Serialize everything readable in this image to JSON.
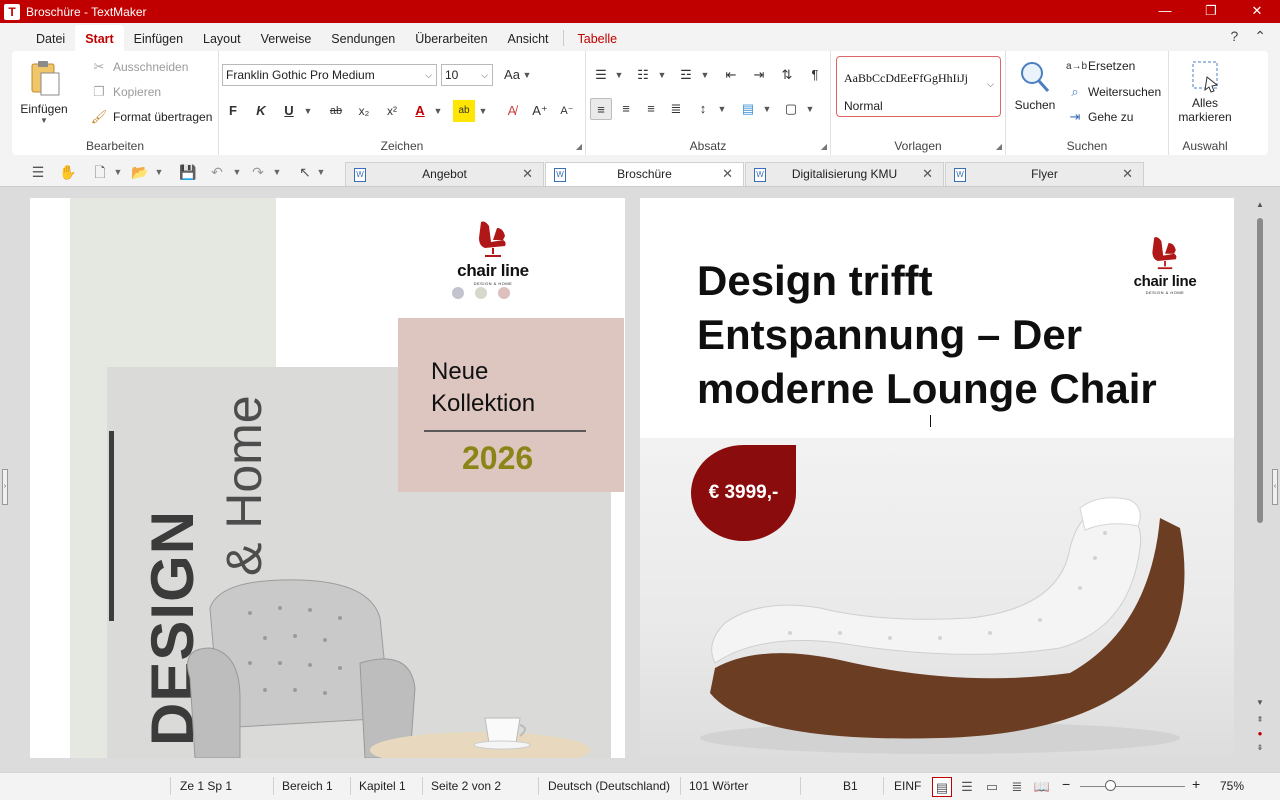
{
  "window": {
    "title": "Broschüre - TextMaker",
    "app_icon_letter": "T",
    "controls": {
      "minimize": "—",
      "maximize": "❐",
      "close": "✕"
    }
  },
  "menu": {
    "items": [
      "Datei",
      "Start",
      "Einfügen",
      "Layout",
      "Verweise",
      "Sendungen",
      "Überarbeiten",
      "Ansicht"
    ],
    "active": "Start",
    "context_tab": "Tabelle",
    "help": "?",
    "collapse": "⌃"
  },
  "ribbon": {
    "bearbeiten": {
      "label": "Bearbeiten",
      "paste": "Einfügen",
      "cut": "Ausschneiden",
      "copy": "Kopieren",
      "format_painter": "Format übertragen"
    },
    "zeichen": {
      "label": "Zeichen",
      "font": "Franklin Gothic Pro Medium",
      "size": "10",
      "bold": "F",
      "italic": "K",
      "underline": "U"
    },
    "absatz": {
      "label": "Absatz"
    },
    "vorlagen": {
      "label": "Vorlagen",
      "sample": "AaBbCcDdEeFfGgHhIiJj",
      "style": "Normal"
    },
    "suchen": {
      "label": "Suchen",
      "search": "Suchen",
      "replace": "Ersetzen",
      "find_next": "Weitersuchen",
      "goto": "Gehe zu"
    },
    "auswahl": {
      "label": "Auswahl",
      "select_all_line1": "Alles",
      "select_all_line2": "markieren"
    }
  },
  "doc_tabs": [
    {
      "label": "Angebot",
      "active": false
    },
    {
      "label": "Broschüre",
      "active": true
    },
    {
      "label": "Digitalisierung KMU",
      "active": false
    },
    {
      "label": "Flyer",
      "active": false
    }
  ],
  "document": {
    "left_page": {
      "vertical_title": "DESIGN",
      "vertical_subtitle": "& Home",
      "logo_text": "chair line",
      "logo_tagline": "DESIGN & HOME",
      "dot_colors": [
        "#c2c3ce",
        "#d5d8cb",
        "#dcc0bd"
      ],
      "collection_line1": "Neue",
      "collection_line2": "Kollektion",
      "year": "2026"
    },
    "right_page": {
      "heading_line1": "Design trifft",
      "heading_line2": "Entspannung – Der",
      "heading_line3": "moderne Lounge Chair",
      "logo_text": "chair line",
      "logo_tagline": "DESIGN & HOME",
      "price": "€ 3999,-"
    }
  },
  "statusbar": {
    "position": "Ze 1 Sp 1",
    "section": "Bereich 1",
    "chapter": "Kapitel 1",
    "page": "Seite 2 von 2",
    "language": "Deutsch (Deutschland)",
    "words": "101 Wörter",
    "cell": "B1",
    "mode": "EINF",
    "zoom": "75%",
    "zoom_minus": "−",
    "zoom_plus": "+"
  },
  "colors": {
    "accent": "#c00000",
    "price_badge": "#8a0c0c",
    "collection_box": "#ddc5c0",
    "year": "#8b8417",
    "logo_red": "#b01818"
  }
}
